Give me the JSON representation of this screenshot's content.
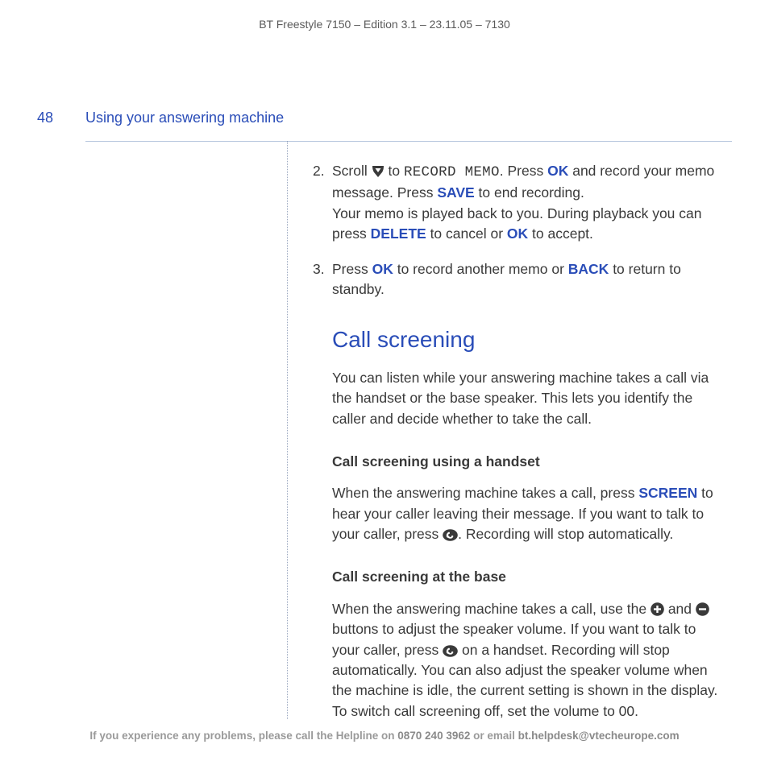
{
  "header": {
    "doc_id": "BT Freestyle 7150 – Edition 3.1 – 23.11.05 – 7130",
    "page_number": "48",
    "section_title": "Using your answering machine"
  },
  "steps": {
    "step2": {
      "num": "2.",
      "part_a": "Scroll ",
      "icon_a": "down-arrow-icon",
      "part_b": " to ",
      "display": "RECORD MEMO",
      "part_c": ". Press ",
      "ok1": "OK",
      "part_d": " and record your memo message. Press ",
      "save": "SAVE",
      "part_e": " to end recording.",
      "line2a": "Your memo is played back to you. During playback you can press ",
      "delete": "DELETE",
      "line2b": " to cancel or ",
      "ok2": "OK",
      "line2c": " to accept."
    },
    "step3": {
      "num": "3.",
      "part_a": "Press ",
      "ok": "OK",
      "part_b": " to record another memo or ",
      "back": "BACK",
      "part_c": " to return to standby."
    }
  },
  "heading": "Call screening",
  "intro": "You can listen while your answering machine takes a call via the handset or the base speaker. This lets you identify the caller and decide whether to take the call.",
  "sub1": {
    "title": "Call screening using a handset",
    "part_a": "When the answering machine takes a call, press ",
    "screen": "SCREEN",
    "part_b": " to hear your caller leaving their message. If you want to talk to your caller, press ",
    "icon": "talk-icon",
    "part_c": ". Recording will stop automatically."
  },
  "sub2": {
    "title": "Call screening at the base",
    "part_a": "When the answering machine takes a call, use the ",
    "icon_plus": "plus-icon",
    "part_b": " and ",
    "icon_minus": "minus-icon",
    "part_c": " buttons to adjust the speaker volume. If you want to talk to your caller, press ",
    "icon_talk": "talk-icon",
    "part_d": " on a handset. Recording will stop automatically. You can also adjust the speaker volume when the machine is idle, the current setting is shown in the display. To switch call screening off, set the volume to 00."
  },
  "footer": {
    "text_a": "If you experience any problems, please call the Helpline on ",
    "phone": "0870 240 3962",
    "text_b": " or email ",
    "email": "bt.helpdesk@vtecheurope.com"
  }
}
